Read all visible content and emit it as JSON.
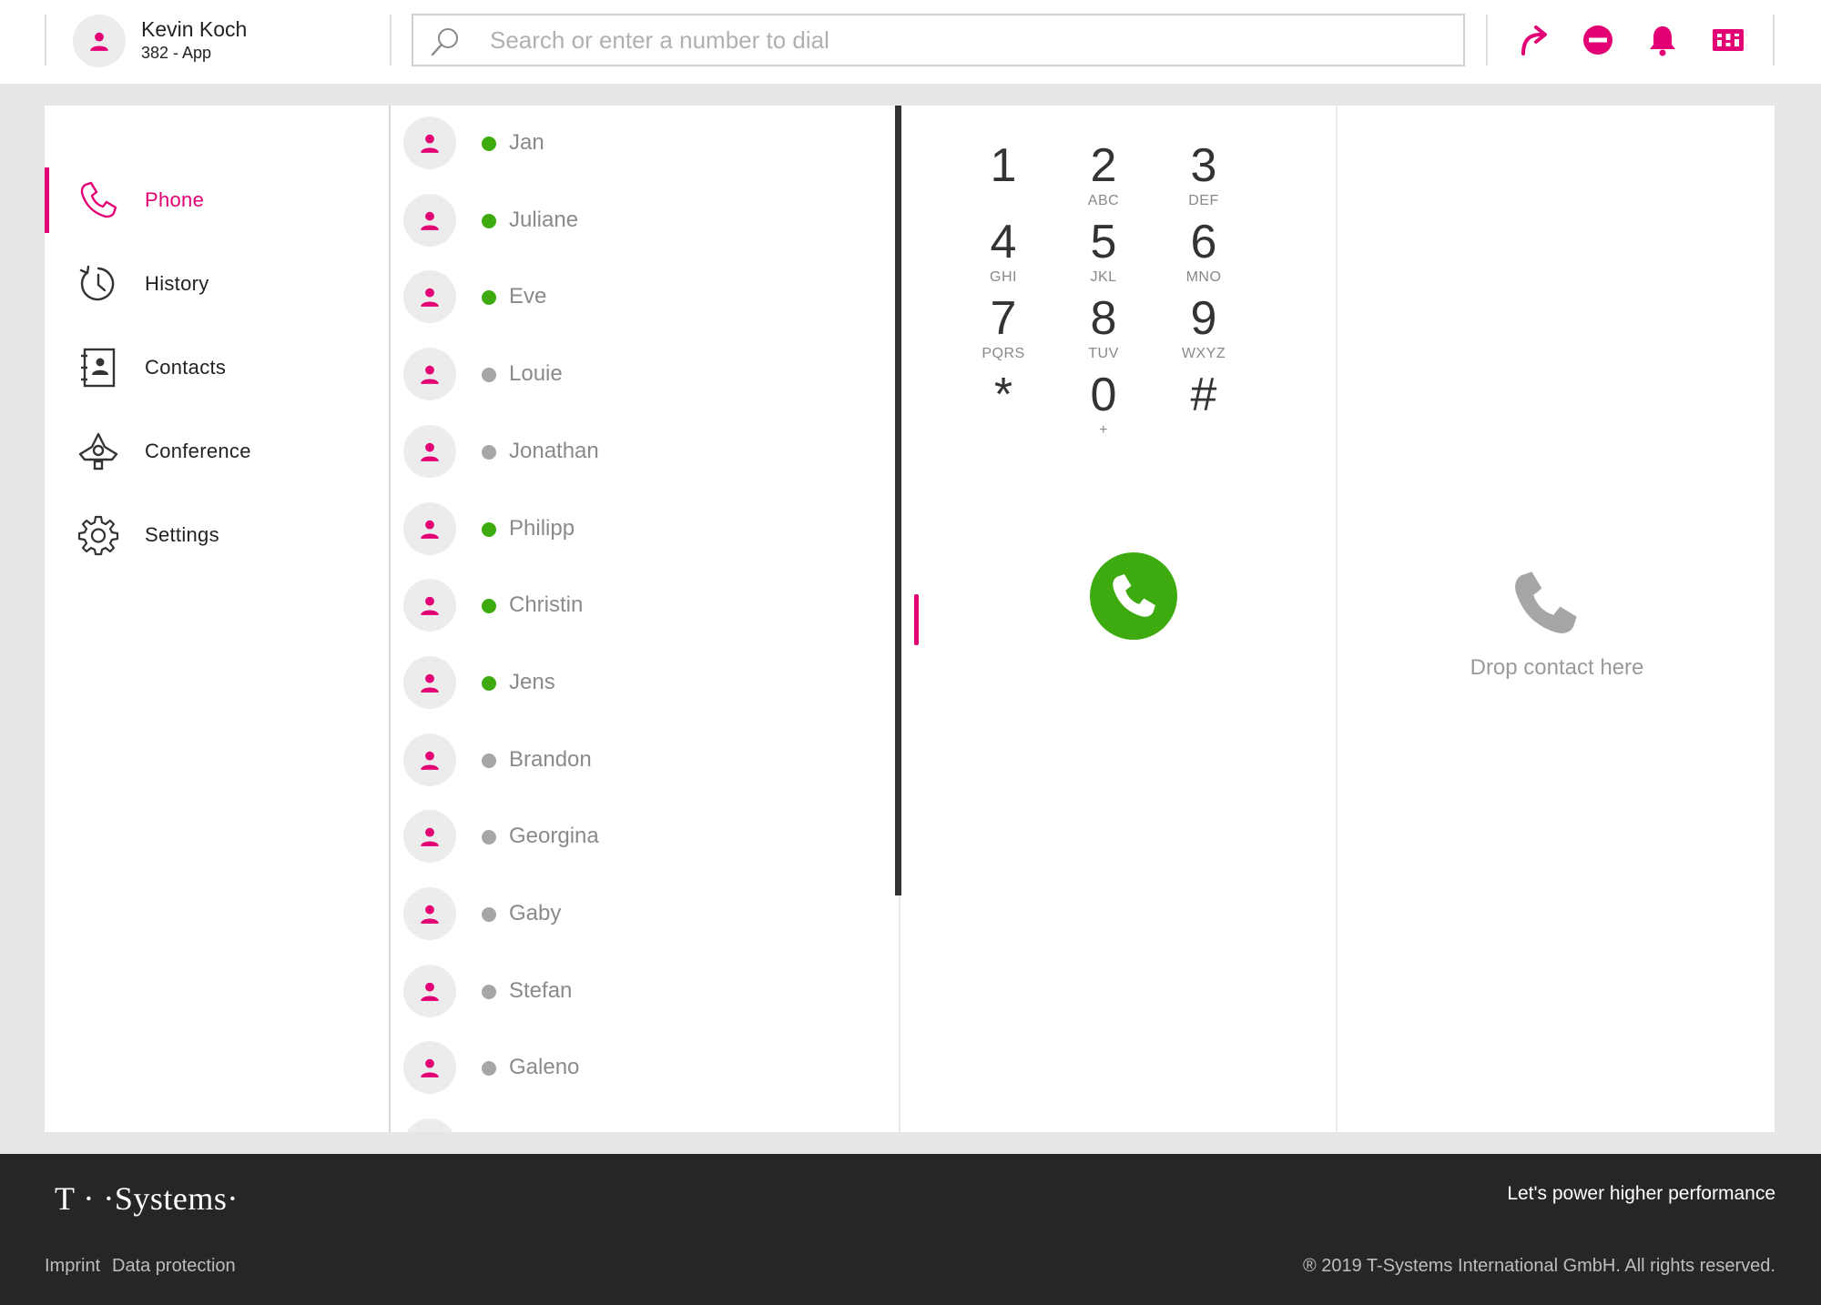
{
  "brand_color": "#e20074",
  "online_color": "#3dab0f",
  "offline_color": "#a6a6a6",
  "user": {
    "name": "Kevin Koch",
    "subtitle": "382 - App"
  },
  "search": {
    "placeholder": "Search or enter a number to dial"
  },
  "header_icons": [
    "call-forward-icon",
    "do-not-disturb-icon",
    "bell-icon",
    "apps-grid-icon"
  ],
  "nav": [
    {
      "label": "Phone",
      "icon": "phone-icon",
      "active": true
    },
    {
      "label": "History",
      "icon": "history-icon",
      "active": false
    },
    {
      "label": "Contacts",
      "icon": "contacts-book-icon",
      "active": false
    },
    {
      "label": "Conference",
      "icon": "conference-icon",
      "active": false
    },
    {
      "label": "Settings",
      "icon": "gear-icon",
      "active": false
    }
  ],
  "contacts": [
    {
      "name": "Jan",
      "status": "online"
    },
    {
      "name": "Juliane",
      "status": "online"
    },
    {
      "name": "Eve",
      "status": "online"
    },
    {
      "name": "Louie",
      "status": "offline"
    },
    {
      "name": "Jonathan",
      "status": "offline"
    },
    {
      "name": "Philipp",
      "status": "online"
    },
    {
      "name": "Christin",
      "status": "online"
    },
    {
      "name": "Jens",
      "status": "online"
    },
    {
      "name": "Brandon",
      "status": "offline"
    },
    {
      "name": "Georgina",
      "status": "offline"
    },
    {
      "name": "Gaby",
      "status": "offline"
    },
    {
      "name": "Stefan",
      "status": "offline"
    },
    {
      "name": "Galeno",
      "status": "offline"
    }
  ],
  "dialpad": [
    {
      "digit": "1",
      "letters": ""
    },
    {
      "digit": "2",
      "letters": "ABC"
    },
    {
      "digit": "3",
      "letters": "DEF"
    },
    {
      "digit": "4",
      "letters": "GHI"
    },
    {
      "digit": "5",
      "letters": "JKL"
    },
    {
      "digit": "6",
      "letters": "MNO"
    },
    {
      "digit": "7",
      "letters": "PQRS"
    },
    {
      "digit": "8",
      "letters": "TUV"
    },
    {
      "digit": "9",
      "letters": "WXYZ"
    },
    {
      "digit": "*",
      "letters": ""
    },
    {
      "digit": "0",
      "letters": "+"
    },
    {
      "digit": "#",
      "letters": ""
    }
  ],
  "dropzone": {
    "text": "Drop contact here",
    "icon": "phone-icon"
  },
  "footer": {
    "brand": "T · ·Systems·",
    "slogan": "Let's power higher performance",
    "imprint": "Imprint",
    "privacy": "Data protection",
    "copyright": "® 2019 T-Systems International GmbH. All rights reserved."
  }
}
